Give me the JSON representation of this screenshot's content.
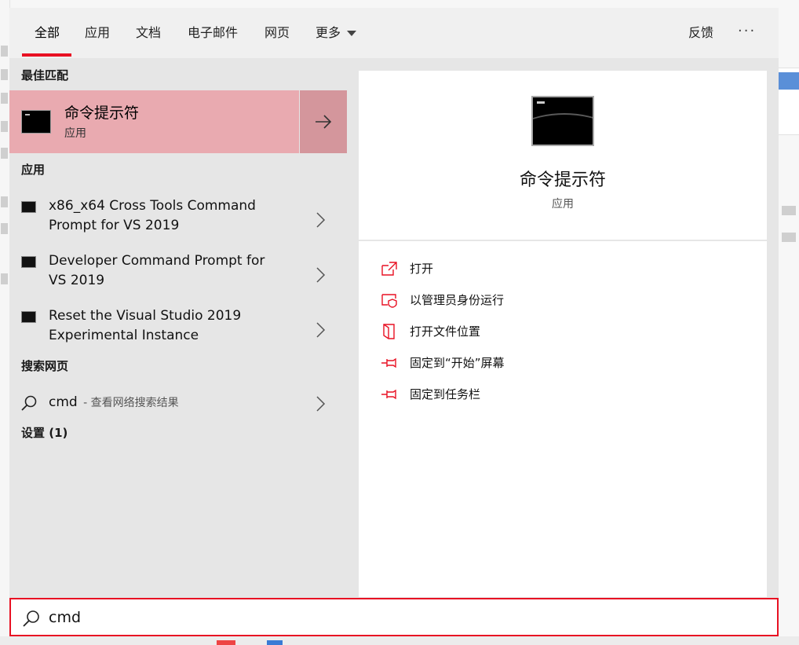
{
  "tabs": [
    {
      "label": "全部",
      "active": true
    },
    {
      "label": "应用"
    },
    {
      "label": "文档"
    },
    {
      "label": "电子邮件"
    },
    {
      "label": "网页"
    },
    {
      "label": "更多"
    }
  ],
  "header": {
    "feedback_label": "反馈",
    "more_options": "···"
  },
  "sections": {
    "best_match": "最佳匹配",
    "apps": "应用",
    "search_web": "搜索网页",
    "settings": "设置 (1)"
  },
  "best_match": {
    "title": "命令提示符",
    "subtitle": "应用"
  },
  "apps": [
    {
      "label": "x86_x64 Cross Tools Command Prompt for VS 2019"
    },
    {
      "label": "Developer Command Prompt for VS 2019"
    },
    {
      "label": "Reset the Visual Studio 2019 Experimental Instance"
    }
  ],
  "web_search": {
    "query": "cmd",
    "hint": "- 查看网络搜索结果"
  },
  "detail": {
    "title": "命令提示符",
    "subtitle": "应用",
    "actions": [
      {
        "label": "打开",
        "icon": "open-icon"
      },
      {
        "label": "以管理员身份运行",
        "icon": "run-as-admin-icon"
      },
      {
        "label": "打开文件位置",
        "icon": "file-location-icon"
      },
      {
        "label": "固定到“开始”屏幕",
        "icon": "pin-icon"
      },
      {
        "label": "固定到任务栏",
        "icon": "pin-icon"
      }
    ]
  },
  "search": {
    "value": "cmd"
  },
  "colors": {
    "accent": "#e81123",
    "selected": "#e9aab0",
    "selected_arrow": "#d4969c"
  }
}
